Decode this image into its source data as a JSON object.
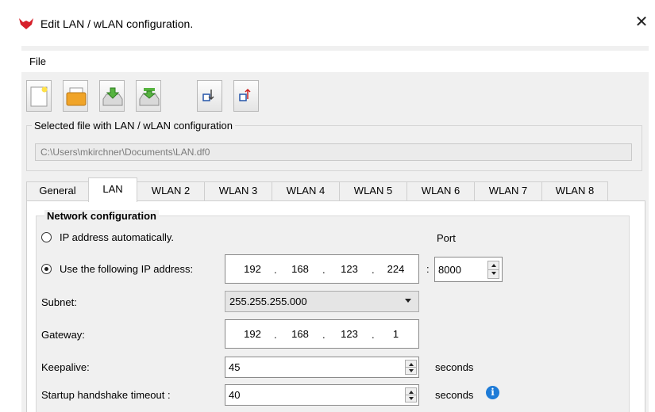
{
  "window": {
    "title": "Edit LAN / wLAN configuration.",
    "close_glyph": "✕",
    "icon": "fox-logo-icon"
  },
  "menu": {
    "file": "File"
  },
  "toolbar": {
    "buttons": [
      "new-file-icon",
      "open-folder-icon",
      "load-device-icon",
      "save-device-icon",
      "import-icon",
      "export-icon"
    ]
  },
  "file_group": {
    "label": "Selected file with LAN / wLAN configuration",
    "path": "C:\\Users\\mkirchner\\Documents\\LAN.df0"
  },
  "tabs": [
    "General",
    "LAN",
    "WLAN 2",
    "WLAN 3",
    "WLAN 4",
    "WLAN 5",
    "WLAN 6",
    "WLAN 7",
    "WLAN 8"
  ],
  "active_tab": "LAN",
  "network": {
    "group_label": "Network configuration",
    "auto_label": "IP address automatically.",
    "port_label": "Port",
    "manual_label": "Use the following IP address:",
    "ip": [
      "192",
      "168",
      "123",
      "224"
    ],
    "port_sep": ":",
    "port": "8000",
    "subnet_label": "Subnet:",
    "subnet": "255.255.255.000",
    "gateway_label": "Gateway:",
    "gateway": [
      "192",
      "168",
      "123",
      "1"
    ],
    "keepalive_label": "Keepalive:",
    "keepalive": "45",
    "keepalive_unit": "seconds",
    "handshake_label": "Startup handshake timeout :",
    "handshake": "40",
    "handshake_unit": "seconds",
    "info_glyph": "i",
    "selected_mode": "manual"
  },
  "colors": {
    "accent_info": "#1e7bd7",
    "logo_red": "#d6202a"
  }
}
